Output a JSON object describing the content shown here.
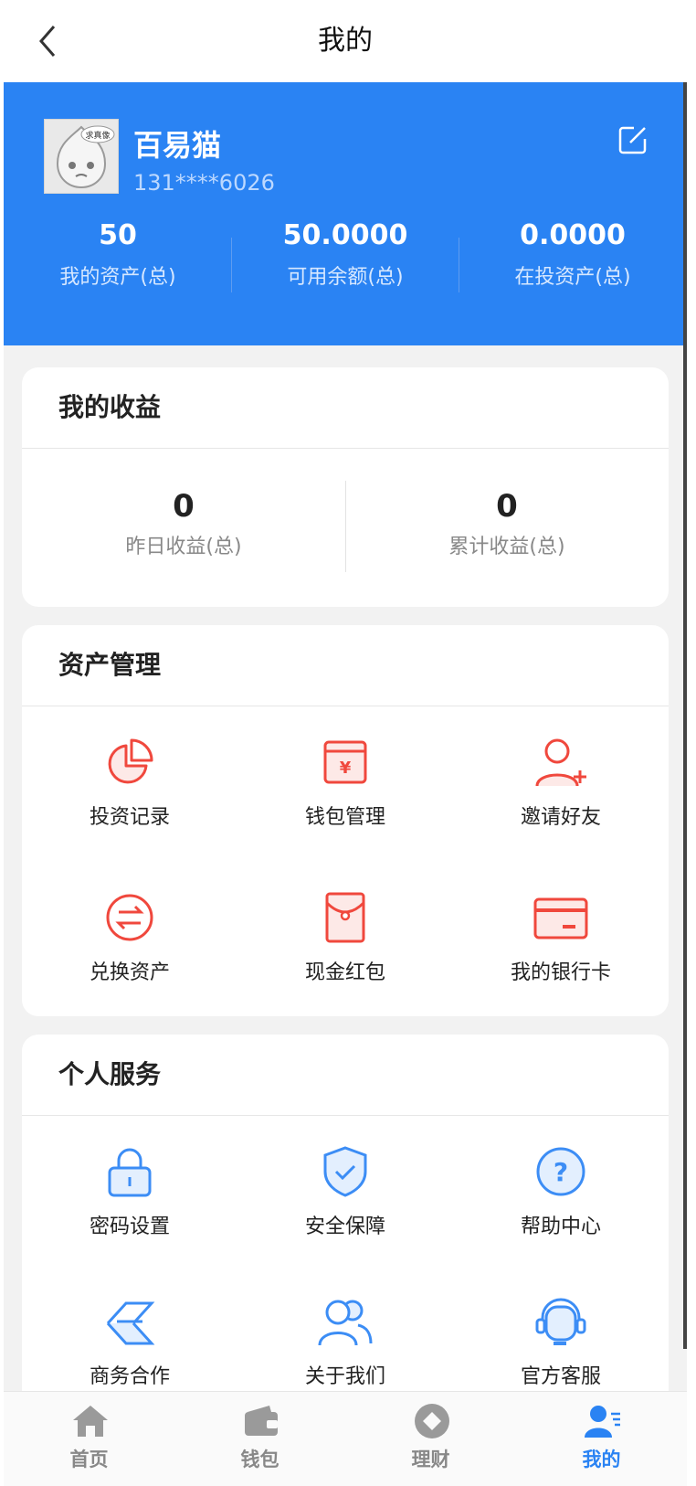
{
  "header": {
    "title": "我的"
  },
  "profile": {
    "name": "百易猫",
    "phone": "131****6026",
    "avatar_badge": "求真像",
    "stats": [
      {
        "value": "50",
        "label": "我的资产(总)"
      },
      {
        "value": "50.0000",
        "label": "可用余额(总)"
      },
      {
        "value": "0.0000",
        "label": "在投资产(总)"
      }
    ]
  },
  "earnings": {
    "title": "我的收益",
    "items": [
      {
        "value": "0",
        "label": "昨日收益(总)"
      },
      {
        "value": "0",
        "label": "累计收益(总)"
      }
    ]
  },
  "assets": {
    "title": "资产管理",
    "items": [
      {
        "label": "投资记录",
        "icon": "pie-chart-icon"
      },
      {
        "label": "钱包管理",
        "icon": "wallet-yen-icon"
      },
      {
        "label": "邀请好友",
        "icon": "add-user-icon"
      },
      {
        "label": "兑换资产",
        "icon": "exchange-icon"
      },
      {
        "label": "现金红包",
        "icon": "red-packet-icon"
      },
      {
        "label": "我的银行卡",
        "icon": "bank-card-icon"
      }
    ]
  },
  "services": {
    "title": "个人服务",
    "items": [
      {
        "label": "密码设置",
        "icon": "lock-icon"
      },
      {
        "label": "安全保障",
        "icon": "shield-check-icon"
      },
      {
        "label": "帮助中心",
        "icon": "help-icon"
      },
      {
        "label": "商务合作",
        "icon": "cooperation-icon"
      },
      {
        "label": "关于我们",
        "icon": "team-icon"
      },
      {
        "label": "官方客服",
        "icon": "customer-service-icon"
      }
    ]
  },
  "tabbar": {
    "items": [
      {
        "label": "首页",
        "icon": "home-icon"
      },
      {
        "label": "钱包",
        "icon": "wallet-icon"
      },
      {
        "label": "理财",
        "icon": "finance-icon"
      },
      {
        "label": "我的",
        "icon": "profile-icon",
        "active": true
      }
    ]
  },
  "colors": {
    "brand_blue": "#2a83f3",
    "accent_red": "#f0483d",
    "icon_blue": "#3c8df5"
  }
}
